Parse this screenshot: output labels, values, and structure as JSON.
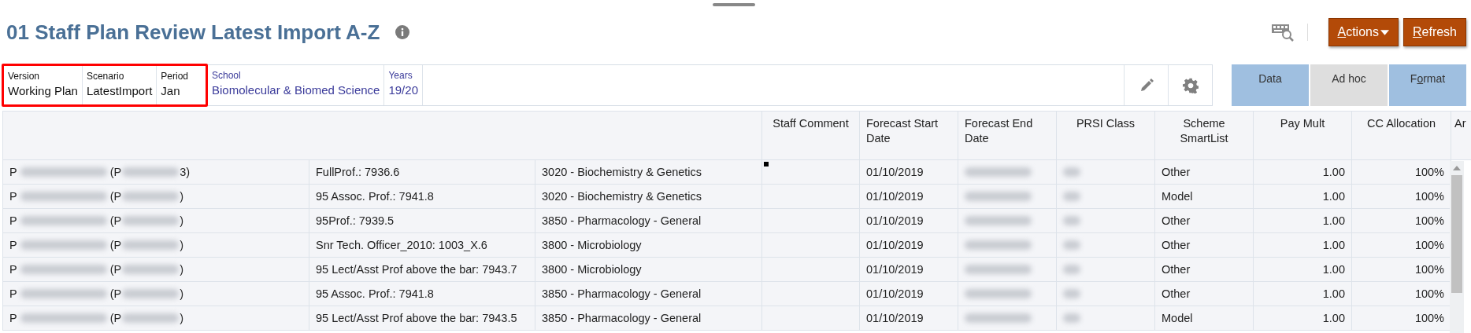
{
  "title": "01 Staff Plan Review Latest Import A-Z",
  "header_buttons": [
    {
      "label": "Actions",
      "dropdown": true
    },
    {
      "label": "Refresh",
      "dropdown": false
    }
  ],
  "pov": [
    {
      "label": "Version",
      "value": "Working Plan",
      "highlighted": true
    },
    {
      "label": "Scenario",
      "value": "LatestImport",
      "highlighted": true
    },
    {
      "label": "Period",
      "value": "Jan",
      "highlighted": true
    },
    {
      "label": "School",
      "value": "Biomolecular & Biomed Science",
      "highlighted": false
    },
    {
      "label": "Years",
      "value": "19/20",
      "highlighted": false
    }
  ],
  "mode_tabs": [
    {
      "text_parts": [
        "Data"
      ],
      "selected": true
    },
    {
      "text_parts": [
        "Ad hoc"
      ],
      "selected": false
    },
    {
      "text_parts": [
        "F",
        "o",
        "rmat"
      ],
      "selected": true
    }
  ],
  "columns": [
    "Staff Comment",
    "Forecast Start Date",
    "Forecast End Date",
    "PRSI Class",
    "Scheme SmartList",
    "Pay Mult",
    "CC Allocation",
    "Ar"
  ],
  "rows": [
    {
      "name_start": "P",
      "name_mid": "(P",
      "name_end": "3)",
      "job": "FullProf.: 7936.6",
      "dept": "3020 - Biochemistry & Genetics",
      "start": "01/10/2019",
      "scheme": "Other",
      "pay_mult": "1.00",
      "cc": "100%"
    },
    {
      "name_start": "P",
      "name_mid": "(P",
      "name_end": ")",
      "job": "95 Assoc. Prof.: 7941.8",
      "dept": "3020 - Biochemistry & Genetics",
      "start": "01/10/2019",
      "scheme": "Model",
      "pay_mult": "1.00",
      "cc": "100%"
    },
    {
      "name_start": "P",
      "name_mid": "(P",
      "name_end": ")",
      "job": "95Prof.: 7939.5",
      "dept": "3850 - Pharmacology - General",
      "start": "01/10/2019",
      "scheme": "Other",
      "pay_mult": "1.00",
      "cc": "100%"
    },
    {
      "name_start": "P",
      "name_mid": "(P",
      "name_end": ")",
      "job": "Snr Tech. Officer_2010: 1003_X.6",
      "dept": "3800 - Microbiology",
      "start": "01/10/2019",
      "scheme": "Other",
      "pay_mult": "1.00",
      "cc": "100%"
    },
    {
      "name_start": "P",
      "name_mid": "(P",
      "name_end": ")",
      "job": "95 Lect/Asst Prof above the bar: 7943.7",
      "dept": "3800 - Microbiology",
      "start": "01/10/2019",
      "scheme": "Other",
      "pay_mult": "1.00",
      "cc": "100%"
    },
    {
      "name_start": "P",
      "name_mid": "(P",
      "name_end": ")",
      "job": "95 Assoc. Prof.: 7941.8",
      "dept": "3850 - Pharmacology - General",
      "start": "01/10/2019",
      "scheme": "Other",
      "pay_mult": "1.00",
      "cc": "100%"
    },
    {
      "name_start": "P",
      "name_mid": "(P",
      "name_end": ")",
      "job": "95 Lect/Asst Prof above the bar: 7943.5",
      "dept": "3850 - Pharmacology - General",
      "start": "01/10/2019",
      "scheme": "Model",
      "pay_mult": "1.00",
      "cc": "100%"
    }
  ]
}
